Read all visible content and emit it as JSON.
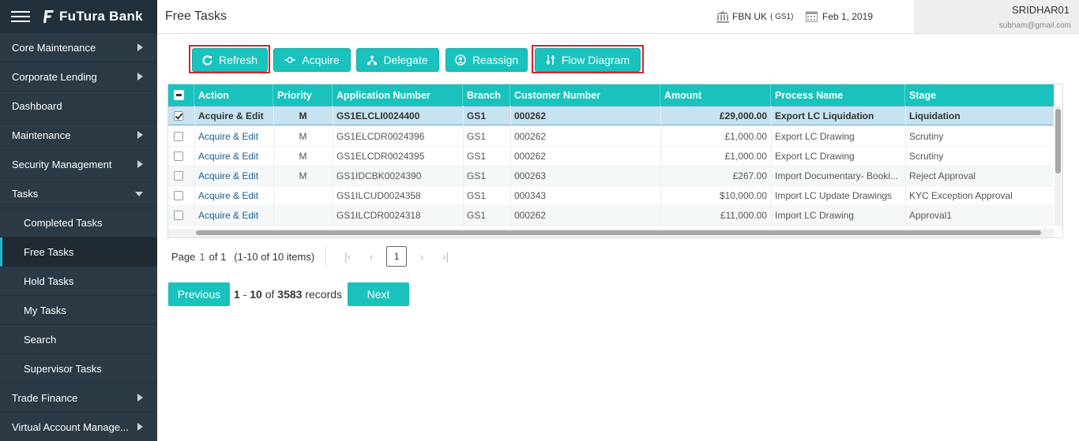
{
  "brand": {
    "name": "FuTura Bank"
  },
  "sidebar": {
    "items": [
      {
        "label": "Core Maintenance"
      },
      {
        "label": "Corporate Lending"
      },
      {
        "label": "Dashboard"
      },
      {
        "label": "Maintenance"
      },
      {
        "label": "Security Management"
      },
      {
        "label": "Tasks"
      },
      {
        "label": "Trade Finance"
      },
      {
        "label": "Virtual Account Manage..."
      }
    ],
    "task_children": [
      {
        "label": "Completed Tasks"
      },
      {
        "label": "Free Tasks"
      },
      {
        "label": "Hold Tasks"
      },
      {
        "label": "My Tasks"
      },
      {
        "label": "Search"
      },
      {
        "label": "Supervisor Tasks"
      }
    ]
  },
  "header": {
    "title": "Free Tasks",
    "entity": "FBN UK",
    "entity_code": "( GS1)",
    "date": "Feb 1, 2019",
    "user": "SRIDHAR01",
    "email": "subham@gmail.com"
  },
  "toolbar": {
    "refresh": "Refresh",
    "acquire": "Acquire",
    "delegate": "Delegate",
    "reassign": "Reassign",
    "flow": "Flow Diagram"
  },
  "table": {
    "columns": [
      "Action",
      "Priority",
      "Application Number",
      "Branch",
      "Customer Number",
      "Amount",
      "Process Name",
      "Stage"
    ],
    "rows": [
      {
        "action": "Acquire & Edit",
        "priority": "M",
        "app": "GS1ELCLI0024400",
        "branch": "GS1",
        "customer": "000262",
        "amount": "£29,000.00",
        "process": "Export LC Liquidation",
        "stage": "Liquidation"
      },
      {
        "action": "Acquire & Edit",
        "priority": "M",
        "app": "GS1ELCDR0024396",
        "branch": "GS1",
        "customer": "000262",
        "amount": "£1,000.00",
        "process": "Export LC Drawing",
        "stage": "Scrutiny"
      },
      {
        "action": "Acquire & Edit",
        "priority": "M",
        "app": "GS1ELCDR0024395",
        "branch": "GS1",
        "customer": "000262",
        "amount": "£1,000.00",
        "process": "Export LC Drawing",
        "stage": "Scrutiny"
      },
      {
        "action": "Acquire & Edit",
        "priority": "M",
        "app": "GS1IDCBK0024390",
        "branch": "GS1",
        "customer": "000263",
        "amount": "£267.00",
        "process": "Import Documentary- Booki...",
        "stage": "Reject Approval"
      },
      {
        "action": "Acquire & Edit",
        "priority": "",
        "app": "GS1ILCUD0024358",
        "branch": "GS1",
        "customer": "000343",
        "amount": "$10,000.00",
        "process": "Import LC Update Drawings",
        "stage": "KYC Exception Approval"
      },
      {
        "action": "Acquire & Edit",
        "priority": "",
        "app": "GS1ILCDR0024318",
        "branch": "GS1",
        "customer": "000262",
        "amount": "£11,000.00",
        "process": "Import LC Drawing",
        "stage": "Approval1"
      }
    ]
  },
  "pager": {
    "page_label": "Page",
    "page": "1",
    "of": "of 1",
    "items": "(1-10 of 10 items)",
    "current": "1"
  },
  "records": {
    "previous": "Previous",
    "next": "Next",
    "range_start": "1",
    "dash": " - ",
    "range_end": "10",
    "of": " of ",
    "total": "3583",
    "suffix": " records"
  },
  "colors": {
    "accent": "#19c2bd",
    "sidebar": "#2b3a45",
    "highlight": "#d9202a"
  }
}
